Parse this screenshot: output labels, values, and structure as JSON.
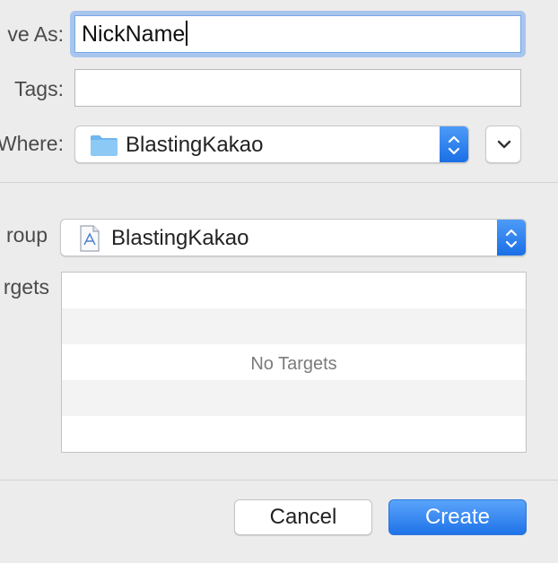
{
  "form": {
    "save_as_label": "ve As:",
    "save_as_value": "NickName",
    "tags_label": "Tags:",
    "tags_value": "",
    "where_label": "Where:",
    "where_value": "BlastingKakao",
    "group_label": "roup",
    "group_value": "BlastingKakao",
    "targets_label": "rgets"
  },
  "targets": {
    "empty_text": "No Targets",
    "items": []
  },
  "buttons": {
    "cancel_label": "Cancel",
    "create_label": "Create"
  },
  "icons": {
    "where": "folder-icon",
    "group": "xcode-project-icon",
    "expand": "chevron-down-icon",
    "popup_arrows": "updown-arrows-icon"
  },
  "colors": {
    "accent": "#1f73e8",
    "focus_ring": "#a8c5ee",
    "window_bg": "#ececec"
  }
}
